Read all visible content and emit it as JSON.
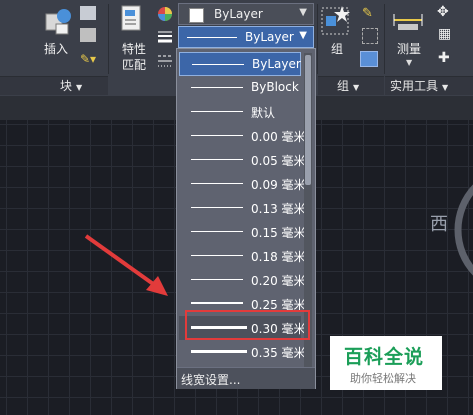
{
  "ribbon": {
    "insert_label": "插入",
    "match_props_label_line1": "特性",
    "match_props_label_line2": "匹配",
    "group_label": "组",
    "measure_label": "测量",
    "panels": {
      "block": "块",
      "group": "组",
      "utilities": "实用工具"
    }
  },
  "properties": {
    "color_value": "ByLayer",
    "lineweight_value": "ByLayer"
  },
  "lineweight_dropdown": {
    "items": [
      {
        "label": "ByLayer",
        "selected": true
      },
      {
        "label": "ByBlock"
      },
      {
        "label": "默认"
      },
      {
        "label": "0.00 毫米"
      },
      {
        "label": "0.05 毫米"
      },
      {
        "label": "0.09 毫米"
      },
      {
        "label": "0.13 毫米"
      },
      {
        "label": "0.15 毫米"
      },
      {
        "label": "0.18 毫米"
      },
      {
        "label": "0.20 毫米"
      },
      {
        "label": "0.25 毫米"
      },
      {
        "label": "0.30 毫米",
        "highlighted": true
      },
      {
        "label": "0.35 毫米"
      }
    ],
    "footer_label": "线宽设置..."
  },
  "canvas": {
    "viewcube_label": "西"
  },
  "watermark": {
    "title": "百科全说",
    "subtitle": "助你轻松解决"
  },
  "colors": {
    "annotation_arrow": "#e23b3b",
    "highlight_box": "#e23b3b",
    "ribbon_bg": "#3b3f49"
  }
}
